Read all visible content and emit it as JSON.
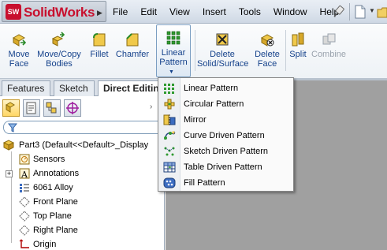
{
  "app": {
    "logo_badge": "SW",
    "logo_text": "SolidWorks"
  },
  "menu": [
    "File",
    "Edit",
    "View",
    "Insert",
    "Tools",
    "Window",
    "Help"
  ],
  "ribbon": {
    "move_face": [
      "Move",
      "Face"
    ],
    "move_copy_bodies": [
      "Move/Copy",
      "Bodies"
    ],
    "fillet": "Fillet",
    "chamfer": "Chamfer",
    "linear_pattern": [
      "Linear",
      "Pattern"
    ],
    "delete_solid_surface": [
      "Delete",
      "Solid/Surface"
    ],
    "delete_face": [
      "Delete",
      "Face"
    ],
    "split": "Split",
    "combine": "Combine"
  },
  "tabs": [
    "Features",
    "Sketch",
    "Direct Editin"
  ],
  "tree": {
    "root": "Part3  (Default<<Default>_Display",
    "items": [
      "Sensors",
      "Annotations",
      "6061 Alloy",
      "Front Plane",
      "Top Plane",
      "Right Plane",
      "Origin"
    ],
    "expander": "+"
  },
  "dropdown": {
    "items": [
      "Linear Pattern",
      "Circular Pattern",
      "Mirror",
      "Curve Driven Pattern",
      "Sketch Driven Pattern",
      "Table Driven Pattern",
      "Fill Pattern"
    ]
  },
  "colors": {
    "brand_red": "#c8102e",
    "ribbon_text": "#15428b",
    "canvas_gray": "#a0a0a0"
  }
}
